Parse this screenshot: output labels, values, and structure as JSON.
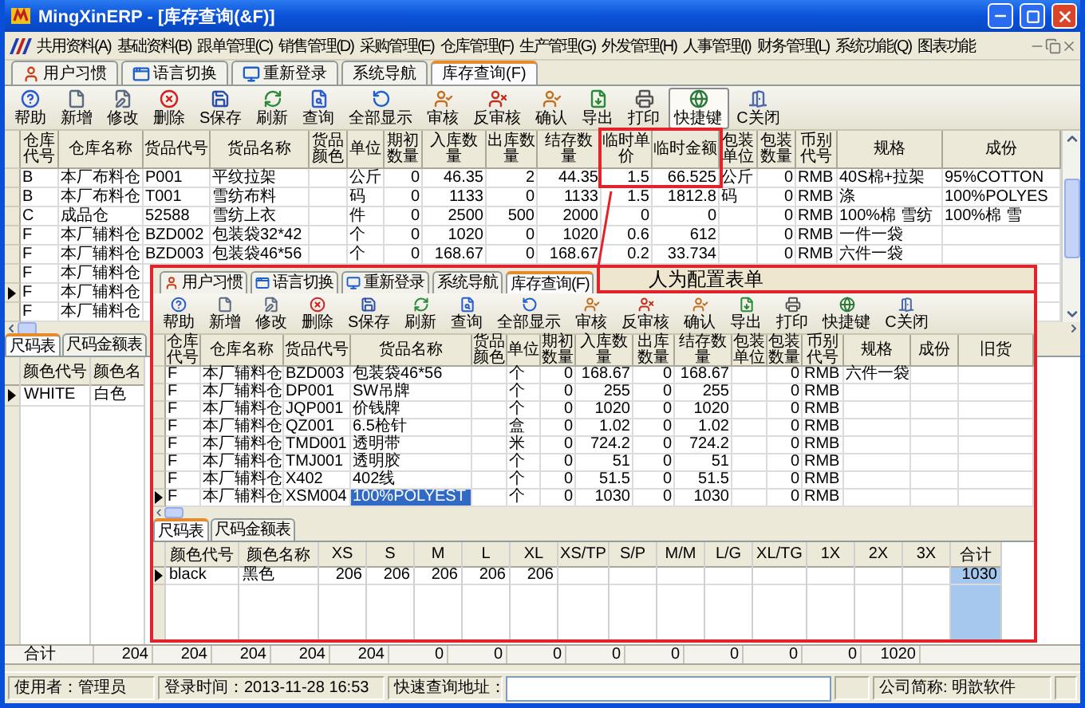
{
  "window": {
    "title": "MingXinERP - [库存查询(&F)]"
  },
  "menu": [
    "共用资料(A)",
    "基础资料(B)",
    "跟单管理(C)",
    "销售管理(D)",
    "采购管理(E)",
    "仓库管理(F)",
    "生产管理(G)",
    "外发管理(H)",
    "人事管理(I)",
    "财务管理(L)",
    "系统功能(Q)",
    "图表功能"
  ],
  "tabs": [
    {
      "label": "用户习惯",
      "selected": false
    },
    {
      "label": "语言切换",
      "selected": false
    },
    {
      "label": "重新登录",
      "selected": false
    },
    {
      "label": "系统导航",
      "selected": false
    },
    {
      "label": "库存查询(F)",
      "selected": true
    }
  ],
  "toolbar": [
    {
      "label": "帮助",
      "pressed": false
    },
    {
      "label": "新增",
      "pressed": false
    },
    {
      "label": "修改",
      "pressed": false
    },
    {
      "label": "删除",
      "pressed": false
    },
    {
      "label": "S保存",
      "pressed": false
    },
    {
      "label": "刷新",
      "pressed": false
    },
    {
      "label": "查询",
      "pressed": false
    },
    {
      "label": "全部显示",
      "pressed": false
    },
    {
      "label": "审核",
      "pressed": false
    },
    {
      "label": "反审核",
      "pressed": false
    },
    {
      "label": "确认",
      "pressed": false
    },
    {
      "label": "导出",
      "pressed": false
    },
    {
      "label": "打印",
      "pressed": false
    },
    {
      "label": "快捷键",
      "pressed": true
    },
    {
      "label": "C关闭",
      "pressed": false
    }
  ],
  "grid": {
    "columns": [
      "仓库代号",
      "仓库名称",
      "货品代号",
      "货品名称",
      "货品颜色",
      "单位",
      "期初数量",
      "入库数量",
      "出库数量",
      "结存数量",
      "临时单价",
      "临时金额",
      "包装单位",
      "包装数量",
      "币别代号",
      "规格",
      "成份"
    ],
    "rows": [
      {
        "cells": [
          "B",
          "本厂布料仓",
          "P001",
          "平纹拉架",
          null,
          "公斤",
          "0",
          "46.35",
          "2",
          "44.35",
          "1.5",
          "66.525",
          "公斤",
          "0",
          "RMB",
          "40S棉+拉架",
          "95%COTTON"
        ],
        "current": false
      },
      {
        "cells": [
          "B",
          "本厂布料仓",
          "T001",
          "雪纺布料",
          null,
          "码",
          "0",
          "1133",
          "0",
          "1133",
          "1.5",
          "1812.8",
          "码",
          "0",
          "RMB",
          "涤",
          "100%POLYES"
        ],
        "current": false
      },
      {
        "cells": [
          "C",
          "成品仓",
          "52588",
          "雪纺上衣",
          null,
          "件",
          "0",
          "2500",
          "500",
          "2000",
          "0",
          "0",
          null,
          "0",
          "RMB",
          "100%棉 雪纺",
          "100%棉 雪"
        ],
        "current": false
      },
      {
        "cells": [
          "F",
          "本厂辅料仓",
          "BZD002",
          "包装袋32*42",
          null,
          "个",
          "0",
          "1020",
          "0",
          "1020",
          "0.6",
          "612",
          null,
          "0",
          "RMB",
          "一件一袋",
          null
        ],
        "current": false
      },
      {
        "cells": [
          "F",
          "本厂辅料仓",
          "BZD003",
          "包装袋46*56",
          null,
          "个",
          "0",
          "168.67",
          "0",
          "168.67",
          "0.2",
          "33.734",
          null,
          "0",
          "RMB",
          "六件一袋",
          null
        ],
        "current": false
      },
      {
        "cells": [
          "F",
          "本厂辅料仓"
        ],
        "current": false
      },
      {
        "cells": [
          "F",
          "本厂辅料仓"
        ],
        "current": true
      },
      {
        "cells": [
          "F",
          "本厂辅料仓"
        ],
        "current": false
      }
    ]
  },
  "size_tabs": [
    {
      "label": "尺码表",
      "selected": true
    },
    {
      "label": "尺码金额表",
      "selected": false
    }
  ],
  "size_grid": {
    "columns": [
      {
        "label": "颜色代号",
        "selected": false
      },
      {
        "label": "颜色名",
        "selected": false
      }
    ],
    "rows": [
      {
        "cells": [
          "WHITE",
          "白色"
        ],
        "current": true
      }
    ]
  },
  "totals": {
    "label": "合计",
    "values": [
      "204",
      "204",
      "204",
      "204",
      "204",
      "0",
      "0",
      "0",
      "0",
      "0",
      "0",
      "0",
      "0",
      "1020"
    ]
  },
  "status_bar": {
    "user": "使用者：管理员",
    "login": "登录时间：2013-11-28 16:53",
    "quick_query_label": "快速查询地址：",
    "company": "公司简称: 明歆软件"
  },
  "inset": {
    "caption": "人为配置表单",
    "tabs": [
      {
        "label": "用户习惯",
        "selected": false
      },
      {
        "label": "语言切换",
        "selected": false
      },
      {
        "label": "重新登录",
        "selected": false
      },
      {
        "label": "系统导航",
        "selected": false
      },
      {
        "label": "库存查询(F)",
        "selected": true
      }
    ],
    "toolbar": [
      {
        "label": "帮助",
        "pressed": false
      },
      {
        "label": "新增",
        "pressed": false
      },
      {
        "label": "修改",
        "pressed": false
      },
      {
        "label": "删除",
        "pressed": false
      },
      {
        "label": "S保存",
        "pressed": false
      },
      {
        "label": "刷新",
        "pressed": false
      },
      {
        "label": "查询",
        "pressed": false
      },
      {
        "label": "全部显示",
        "pressed": false
      },
      {
        "label": "审核",
        "pressed": false
      },
      {
        "label": "反审核",
        "pressed": false
      },
      {
        "label": "确认",
        "pressed": false
      },
      {
        "label": "导出",
        "pressed": false
      },
      {
        "label": "打印",
        "pressed": false
      },
      {
        "label": "快捷键",
        "pressed": false
      },
      {
        "label": "C关闭",
        "pressed": false
      }
    ],
    "grid": {
      "columns": [
        "仓库代号",
        "仓库名称",
        "货品代号",
        "货品名称",
        "货品颜色",
        "单位",
        "期初数量",
        "入库数量",
        "出库数量",
        "结存数量",
        "包装单位",
        "包装数量",
        "币别代号",
        "规格",
        "成份",
        "旧货"
      ],
      "rows": [
        {
          "cells": [
            "F",
            "本厂辅料仓",
            "BZD003",
            "包装袋46*56",
            null,
            "个",
            "0",
            "168.67",
            "0",
            "168.67",
            null,
            "0",
            "RMB",
            "六件一袋"
          ],
          "current": false
        },
        {
          "cells": [
            "F",
            "本厂辅料仓",
            "DP001",
            "SW吊牌",
            null,
            "个",
            "0",
            "255",
            "0",
            "255",
            null,
            "0",
            "RMB"
          ],
          "current": false
        },
        {
          "cells": [
            "F",
            "本厂辅料仓",
            "JQP001",
            "价钱牌",
            null,
            "个",
            "0",
            "1020",
            "0",
            "1020",
            null,
            "0",
            "RMB"
          ],
          "current": false
        },
        {
          "cells": [
            "F",
            "本厂辅料仓",
            "QZ001",
            "6.5枪针",
            null,
            "盒",
            "0",
            "1.02",
            "0",
            "1.02",
            null,
            "0",
            "RMB"
          ],
          "current": false
        },
        {
          "cells": [
            "F",
            "本厂辅料仓",
            "TMD001",
            "透明带",
            null,
            "米",
            "0",
            "724.2",
            "0",
            "724.2",
            null,
            "0",
            "RMB"
          ],
          "current": false
        },
        {
          "cells": [
            "F",
            "本厂辅料仓",
            "TMJ001",
            "透明胶",
            null,
            "个",
            "0",
            "51",
            "0",
            "51",
            null,
            "0",
            "RMB"
          ],
          "current": false
        },
        {
          "cells": [
            "F",
            "本厂辅料仓",
            "X402",
            "402线",
            null,
            "个",
            "0",
            "51.5",
            "0",
            "51.5",
            null,
            "0",
            "RMB"
          ],
          "current": false
        },
        {
          "cells": [
            "F",
            "本厂辅料仓",
            "XSM004",
            {
              "text": "100%POLYEST",
              "selected": true
            },
            null,
            "个",
            "0",
            "1030",
            "0",
            "1030",
            null,
            "0",
            "RMB"
          ],
          "current": true
        }
      ]
    },
    "size_tabs": [
      {
        "label": "尺码表",
        "selected": true
      },
      {
        "label": "尺码金额表",
        "selected": false
      }
    ],
    "size_grid": {
      "columns": [
        {
          "label": "颜色代号",
          "selected": false
        },
        {
          "label": "颜色名称",
          "selected": false
        },
        {
          "label": "XS",
          "selected": false
        },
        {
          "label": "S",
          "selected": false
        },
        {
          "label": "M",
          "selected": false
        },
        {
          "label": "L",
          "selected": false
        },
        {
          "label": "XL",
          "selected": false
        },
        {
          "label": "XS/TP",
          "selected": false
        },
        {
          "label": "S/P",
          "selected": false
        },
        {
          "label": "M/M",
          "selected": false
        },
        {
          "label": "L/G",
          "selected": false
        },
        {
          "label": "XL/TG",
          "selected": false
        },
        {
          "label": "1X",
          "selected": false
        },
        {
          "label": "2X",
          "selected": false
        },
        {
          "label": "3X",
          "selected": false
        },
        {
          "label": "合计",
          "selected": true
        }
      ],
      "rows": [
        {
          "cells": [
            "black",
            "黑色",
            "206",
            "206",
            "206",
            "206",
            "206",
            null,
            null,
            null,
            null,
            null,
            null,
            null,
            null,
            "1030"
          ],
          "current": true
        }
      ]
    }
  }
}
